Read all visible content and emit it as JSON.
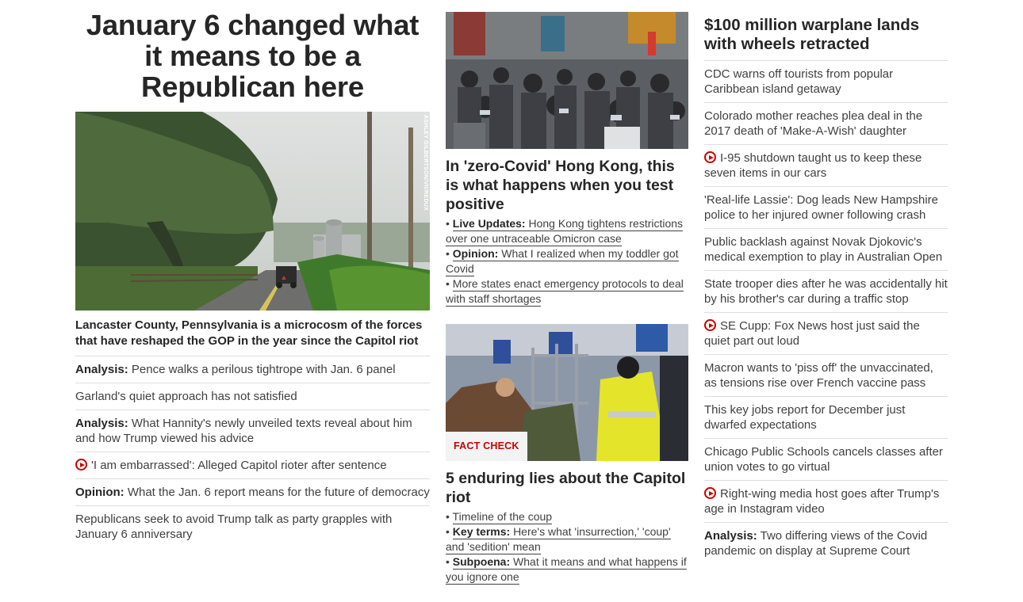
{
  "col1": {
    "headline": "January 6 changed what it means to be a Republican here",
    "image_credit": "ASHLEY GILBERTSON/VII/REDUX",
    "caption": "Lancaster County, Pennsylvania is a microcosm of the forces that have reshaped the GOP in the year since the Capitol riot",
    "items": [
      {
        "prefix": "Analysis:",
        "text": "Pence walks a perilous tightrope with Jan. 6 panel",
        "video": false
      },
      {
        "prefix": "",
        "text": "Garland's quiet approach has not satisfied",
        "video": false
      },
      {
        "prefix": "Analysis:",
        "text": "What Hannity's newly unveiled texts reveal about him and how Trump viewed his advice",
        "video": false
      },
      {
        "prefix": "",
        "text": "'I am embarrassed': Alleged Capitol rioter after sentence",
        "video": true
      },
      {
        "prefix": "Opinion:",
        "text": "What the Jan. 6 report means for the future of democracy",
        "video": false
      },
      {
        "prefix": "",
        "text": "Republicans seek to avoid Trump talk as party grapples with January 6 anniversary",
        "video": false
      }
    ]
  },
  "col2": {
    "story1": {
      "headline": "In 'zero-Covid' Hong Kong, this is what happens when you test positive",
      "bullets": [
        {
          "prefix": "Live Updates:",
          "text": "Hong Kong tightens restrictions over one untraceable Omicron case"
        },
        {
          "prefix": "Opinion:",
          "text": "What I realized when my toddler got Covid"
        },
        {
          "prefix": "",
          "text": "More states enact emergency protocols to deal with staff shortages"
        }
      ]
    },
    "story2": {
      "label": "FACT CHECK",
      "headline": "5 enduring lies about the Capitol riot",
      "bullets": [
        {
          "prefix": "",
          "text": "Timeline of the coup"
        },
        {
          "prefix": "Key terms:",
          "text": "Here's what 'insurrection,' 'coup' and 'sedition' mean"
        },
        {
          "prefix": "Subpoena:",
          "text": "What it means and what happens if you ignore one"
        }
      ]
    }
  },
  "col3": {
    "headline": "$100 million warplane lands with wheels retracted",
    "items": [
      {
        "prefix": "",
        "text": "CDC warns off tourists from popular Caribbean island getaway",
        "video": false
      },
      {
        "prefix": "",
        "text": "Colorado mother reaches plea deal in the 2017 death of 'Make-A-Wish' daughter",
        "video": false
      },
      {
        "prefix": "",
        "text": "I-95 shutdown taught us to keep these seven items in our cars",
        "video": true
      },
      {
        "prefix": "",
        "text": "'Real-life Lassie': Dog leads New Hampshire police to her injured owner following crash",
        "video": false
      },
      {
        "prefix": "",
        "text": "Public backlash against Novak Djokovic's medical exemption to play in Australian Open",
        "video": false
      },
      {
        "prefix": "",
        "text": "State trooper dies after he was accidentally hit by his brother's car during a traffic stop",
        "video": false
      },
      {
        "prefix": "",
        "text": "SE Cupp: Fox News host just said the quiet part out loud",
        "video": true
      },
      {
        "prefix": "",
        "text": "Macron wants to 'piss off' the unvaccinated, as tensions rise over French vaccine pass",
        "video": false
      },
      {
        "prefix": "",
        "text": "This key jobs report for December just dwarfed expectations",
        "video": false
      },
      {
        "prefix": "",
        "text": "Chicago Public Schools cancels classes after union votes to go virtual",
        "video": false
      },
      {
        "prefix": "",
        "text": "Right-wing media host goes after Trump's age in Instagram video",
        "video": true
      },
      {
        "prefix": "Analysis:",
        "text": "Two differing views of the Covid pandemic on display at Supreme Court",
        "video": false
      }
    ]
  }
}
